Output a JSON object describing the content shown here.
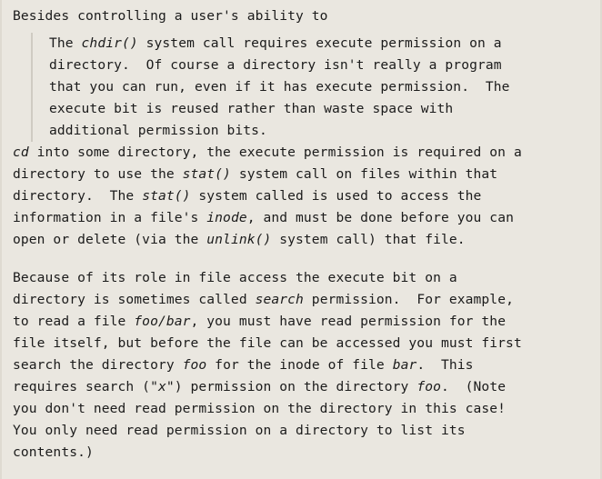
{
  "document": {
    "background_color": "#eae7e0",
    "text_color": "#1b1b1b",
    "rule_color": "#cfcbc2",
    "blocks": [
      {
        "id": "intro",
        "type": "paragraph",
        "text": "Besides controlling a user's ability to"
      },
      {
        "id": "blockquote",
        "type": "blockquote",
        "segments": [
          {
            "text": "The ",
            "style": "normal"
          },
          {
            "text": "chdir()",
            "style": "italic"
          },
          {
            "text": " system call requires execute permission on a\ndirectory.  Of course a directory isn't really a program\nthat you can run, even if it has execute permission.  The\nexecute bit is reused rather than waste space with\nadditional permission bits.",
            "style": "normal"
          }
        ]
      },
      {
        "id": "para-cd",
        "type": "paragraph",
        "segments": [
          {
            "text": "cd",
            "style": "italic"
          },
          {
            "text": " into some directory, the execute permission is required on a\ndirectory to use the ",
            "style": "normal"
          },
          {
            "text": "stat()",
            "style": "italic"
          },
          {
            "text": " system call on files within that\ndirectory.  The ",
            "style": "normal"
          },
          {
            "text": "stat()",
            "style": "italic"
          },
          {
            "text": " system called is used to access the\ninformation in a file's ",
            "style": "normal"
          },
          {
            "text": "inode",
            "style": "italic"
          },
          {
            "text": ", and must be done before you can\nopen or delete (via the ",
            "style": "normal"
          },
          {
            "text": "unlink()",
            "style": "italic"
          },
          {
            "text": " system call) that file.",
            "style": "normal"
          }
        ]
      },
      {
        "id": "para-search",
        "type": "paragraph",
        "segments": [
          {
            "text": "Because of its role in file access the execute bit on a\ndirectory is sometimes called ",
            "style": "normal"
          },
          {
            "text": "search",
            "style": "italic"
          },
          {
            "text": " permission.  For example,\nto read a file ",
            "style": "normal"
          },
          {
            "text": "foo/bar",
            "style": "italic"
          },
          {
            "text": ", you must have read permission for the\nfile itself, but before the file can be accessed you must first\nsearch the directory ",
            "style": "normal"
          },
          {
            "text": "foo",
            "style": "italic"
          },
          {
            "text": " for the inode of file ",
            "style": "normal"
          },
          {
            "text": "bar",
            "style": "italic"
          },
          {
            "text": ".  This\nrequires search (\"",
            "style": "normal"
          },
          {
            "text": "x",
            "style": "italic"
          },
          {
            "text": "\") permission on the directory ",
            "style": "normal"
          },
          {
            "text": "foo",
            "style": "italic"
          },
          {
            "text": ".  (Note\nyou don't need read permission on the directory in this case!\nYou only need read permission on a directory to list its\ncontents.)",
            "style": "normal"
          }
        ]
      }
    ]
  }
}
